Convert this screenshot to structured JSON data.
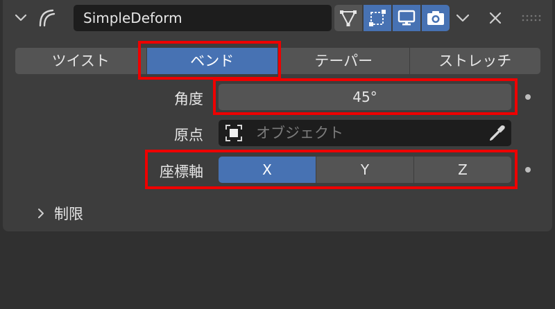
{
  "modifier": {
    "name": "SimpleDeform"
  },
  "modes": [
    "ツイスト",
    "ベンド",
    "テーパー",
    "ストレッチ"
  ],
  "active_mode": "ベンド",
  "properties": {
    "angle_label": "角度",
    "angle_value": "45°",
    "origin_label": "原点",
    "origin_placeholder": "オブジェクト",
    "axis_label": "座標軸",
    "axes": [
      "X",
      "Y",
      "Z"
    ],
    "active_axis": "X"
  },
  "subpanel": {
    "label": "制限"
  },
  "colors": {
    "accent": "#4772b3",
    "highlight": "#ee0000",
    "panel": "#3d3d3d",
    "field": "#545454"
  }
}
